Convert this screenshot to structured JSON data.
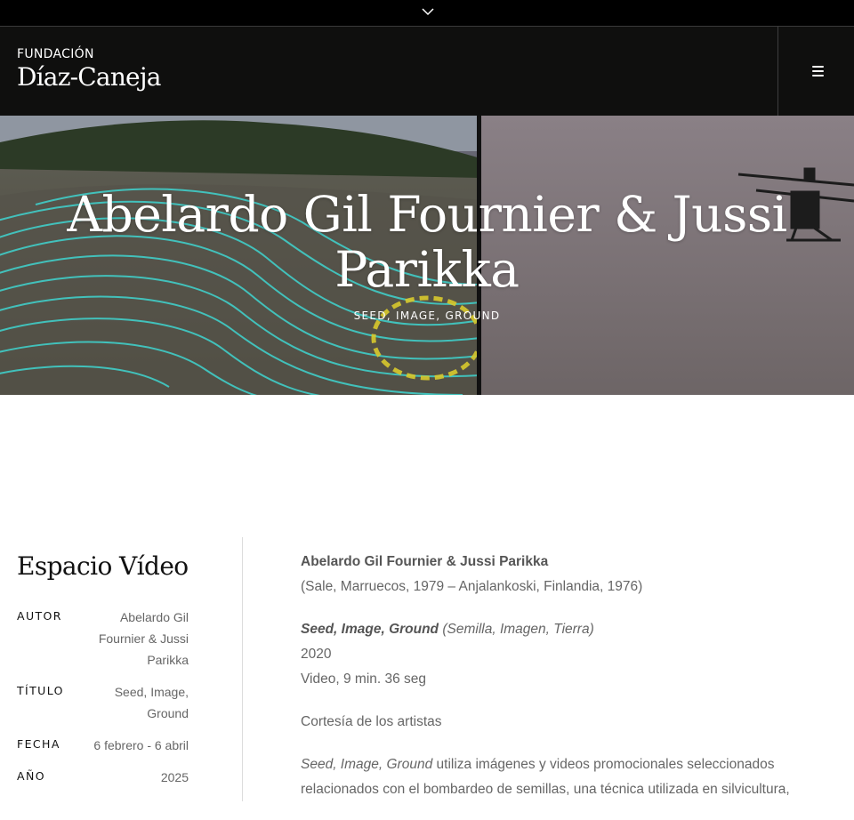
{
  "topbar": {
    "toggle_icon": "chevron-down-icon"
  },
  "header": {
    "logo_small": "FUNDACIÓN",
    "logo_big": "Díaz-Caneja",
    "menu_icon": "hamburger-icon"
  },
  "hero": {
    "title": "Abelardo Gil Fournier & Jussi Parikka",
    "subtitle": "SEED, IMAGE, GROUND"
  },
  "sidebar": {
    "title": "Espacio Vídeo",
    "meta": [
      {
        "key": "AUTOR",
        "value": "Abelardo Gil Fournier & Jussi Parikka"
      },
      {
        "key": "TÍTULO",
        "value": "Seed, Image, Ground"
      },
      {
        "key": "FECHA",
        "value": "6 febrero - 6 abril"
      },
      {
        "key": "AÑO",
        "value": "2025"
      }
    ]
  },
  "content": {
    "artists": "Abelardo Gil Fournier & Jussi Parikka",
    "origins": "(Sale, Marruecos, 1979 – Anjalankoski, Finlandia, 1976)",
    "work_title": "Seed, Image, Ground",
    "work_title_es": "(Semilla, Imagen, Tierra)",
    "year": "2020",
    "medium": "Video, 9 min. 36 seg",
    "courtesy": "Cortesía de los artistas",
    "desc_title": "Seed, Image, Ground",
    "desc_line1": " utiliza imágenes y videos promocionales seleccionados",
    "desc_line2": "relacionados con el bombardeo de semillas, una técnica utilizada en silvicultura,"
  }
}
